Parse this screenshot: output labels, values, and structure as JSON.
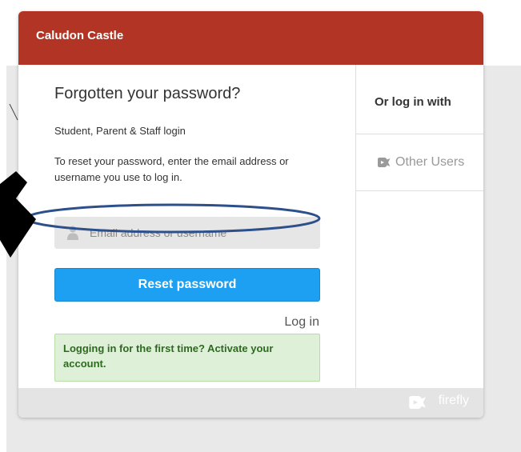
{
  "header": {
    "school_name": "Caludon Castle"
  },
  "form": {
    "title": "Forgotten your password?",
    "subtitle": "Student, Parent & Staff login",
    "instructions": "To reset your password, enter the email address or username you use to log in.",
    "email_placeholder": "Email address or username",
    "email_value": "",
    "reset_button_label": "Reset password",
    "login_link": "Log in",
    "activate_notice": "Logging in for the first time? Activate your account."
  },
  "side": {
    "heading": "Or log in with",
    "other_users_label": "Other Users"
  },
  "footer": {
    "brand": "firefly"
  },
  "colors": {
    "header_bg": "#b23424",
    "button_bg": "#1ea0f2",
    "notice_bg": "#dff0d8",
    "annotation": "#2d4f8a"
  },
  "icons": {
    "field_icon": "user-icon",
    "other_users_icon": "firefly-logo-icon",
    "footer_icon": "firefly-logo-icon",
    "annotation_pointer": "arrow-icon"
  }
}
